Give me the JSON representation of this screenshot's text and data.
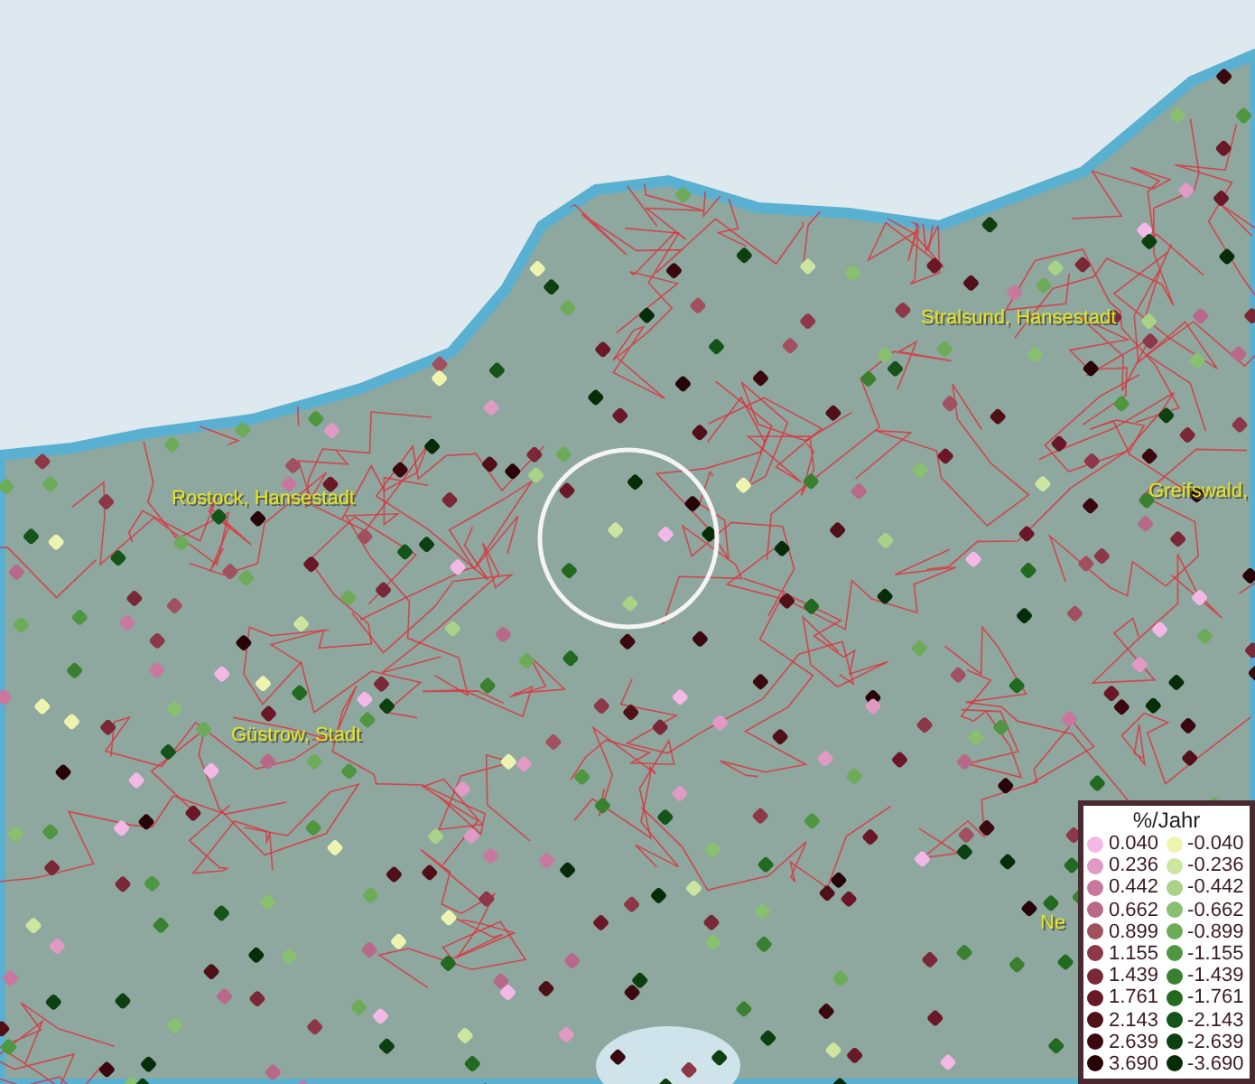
{
  "map": {
    "labels": [
      {
        "text": "Rostock, Hansestadt"
      },
      {
        "text": "Stralsund, Hansestadt"
      },
      {
        "text": "Greifswald,"
      },
      {
        "text": "Güstrow, Stadt"
      },
      {
        "text": "Ne"
      }
    ]
  },
  "legend": {
    "title": "%/Jahr",
    "columns": [
      {
        "entries": [
          {
            "value": "0.040",
            "color": "#f4b8e6"
          },
          {
            "value": "0.236",
            "color": "#e09ac4"
          },
          {
            "value": "0.442",
            "color": "#c8789e"
          },
          {
            "value": "0.662",
            "color": "#b86888"
          },
          {
            "value": "0.899",
            "color": "#a0505e"
          },
          {
            "value": "1.155",
            "color": "#8c3848"
          },
          {
            "value": "1.439",
            "color": "#7a2838"
          },
          {
            "value": "1.761",
            "color": "#6a1828"
          },
          {
            "value": "2.143",
            "color": "#501018"
          },
          {
            "value": "2.639",
            "color": "#3c0810"
          },
          {
            "value": "3.690",
            "color": "#280408"
          }
        ]
      },
      {
        "entries": [
          {
            "value": "-0.040",
            "color": "#eef4b0"
          },
          {
            "value": "-0.236",
            "color": "#cce6a0"
          },
          {
            "value": "-0.442",
            "color": "#a8d288"
          },
          {
            "value": "-0.662",
            "color": "#88c070"
          },
          {
            "value": "-0.899",
            "color": "#6cac58"
          },
          {
            "value": "-1.155",
            "color": "#4e9640"
          },
          {
            "value": "-1.439",
            "color": "#3a8030"
          },
          {
            "value": "-1.761",
            "color": "#226a20"
          },
          {
            "value": "-2.143",
            "color": "#145418"
          },
          {
            "value": "-2.639",
            "color": "#0c4010"
          },
          {
            "value": "-3.690",
            "color": "#062c08"
          }
        ]
      }
    ]
  }
}
